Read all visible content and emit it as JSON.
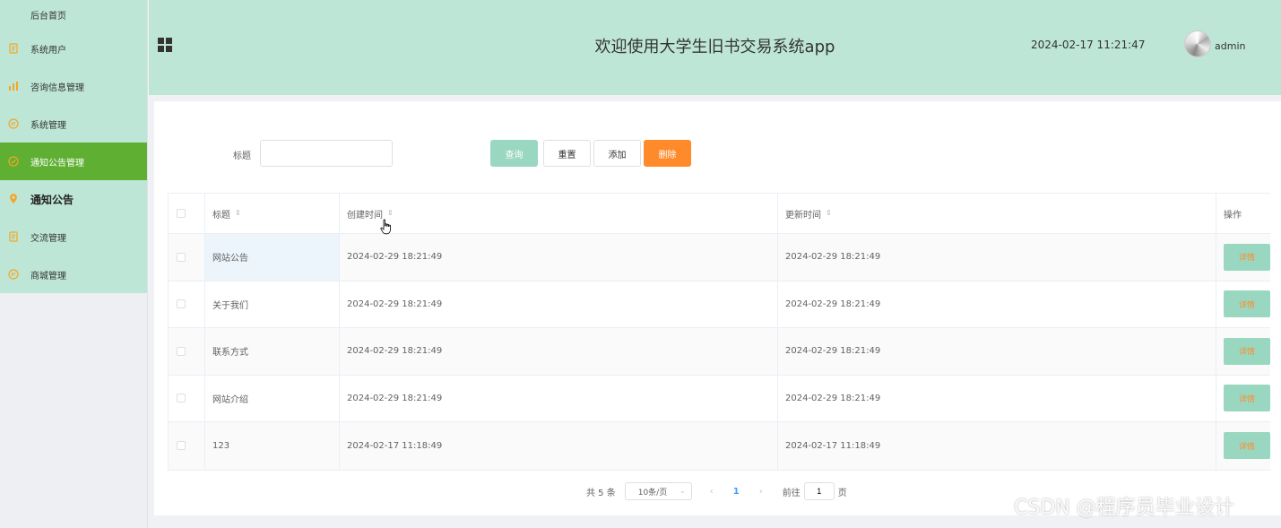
{
  "sidebar": {
    "items": [
      {
        "label": "后台首页",
        "icon": "home-icon",
        "active": false,
        "color": ""
      },
      {
        "label": "系统用户",
        "icon": "document-icon",
        "active": false,
        "color": "#f5a623"
      },
      {
        "label": "咨询信息管理",
        "icon": "bar-chart-icon",
        "active": false,
        "color": "#f5a623"
      },
      {
        "label": "系统管理",
        "icon": "chat-bubble-icon",
        "active": false,
        "color": "#f5a623"
      },
      {
        "label": "通知公告管理",
        "icon": "check-circle-icon",
        "active": true,
        "color": "#f5a623"
      },
      {
        "label": "通知公告",
        "icon": "location-pin-icon",
        "active": false,
        "color": "#f5a623"
      },
      {
        "label": "交流管理",
        "icon": "document-icon",
        "active": false,
        "color": "#f5a623"
      },
      {
        "label": "商城管理",
        "icon": "chat-bubble-icon",
        "active": false,
        "color": "#f5a623"
      }
    ]
  },
  "header": {
    "title": "欢迎使用大学生旧书交易系统app",
    "datetime": "2024-02-17 11:21:47",
    "username": "admin"
  },
  "search": {
    "label": "标题",
    "value": "",
    "query_label": "查询",
    "reset_label": "重置",
    "add_label": "添加",
    "delete_label": "删除"
  },
  "table": {
    "columns": {
      "title": "标题",
      "created": "创建时间",
      "updated": "更新时间",
      "op": "操作"
    },
    "detail_label": "详情",
    "rows": [
      {
        "title": "网站公告",
        "created": "2024-02-29 18:21:49",
        "updated": "2024-02-29 18:21:49"
      },
      {
        "title": "关于我们",
        "created": "2024-02-29 18:21:49",
        "updated": "2024-02-29 18:21:49"
      },
      {
        "title": "联系方式",
        "created": "2024-02-29 18:21:49",
        "updated": "2024-02-29 18:21:49"
      },
      {
        "title": "网站介绍",
        "created": "2024-02-29 18:21:49",
        "updated": "2024-02-29 18:21:49"
      },
      {
        "title": "123",
        "created": "2024-02-17 11:18:49",
        "updated": "2024-02-17 11:18:49"
      }
    ]
  },
  "pagination": {
    "total_text": "共 5 条",
    "page_size": "10条/页",
    "current_page": "1",
    "goto_label": "前往",
    "goto_value": "1",
    "goto_unit": "页"
  },
  "watermark": "CSDN @程序员毕业设计",
  "colors": {
    "header_bg": "#bde6d6",
    "active_menu": "#5faf32",
    "primary_button": "#9ad7c1",
    "danger_button": "#ff8a2b",
    "icon_orange": "#f5a623"
  }
}
